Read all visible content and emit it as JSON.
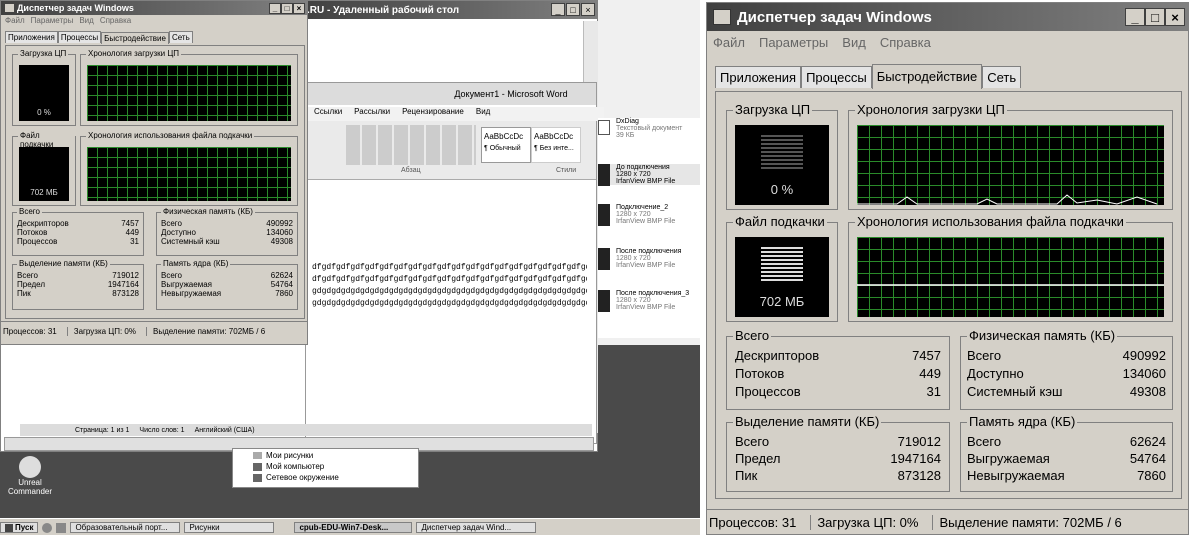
{
  "tm": {
    "title": "Диспетчер задач Windows",
    "menu": [
      "Файл",
      "Параметры",
      "Вид",
      "Справка"
    ],
    "tabs": [
      "Приложения",
      "Процессы",
      "Быстродействие",
      "Сеть"
    ],
    "active_tab": 2,
    "cpu_label": "Загрузка ЦП",
    "cpu_value": "0 %",
    "cpu_history_label": "Хронология загрузки ЦП",
    "pf_label": "Файл подкачки",
    "pf_value": "702 МБ",
    "pf_history_label": "Хронология использования файла подкачки",
    "totals": {
      "label": "Всего",
      "rows": [
        [
          "Дескрипторов",
          "7457"
        ],
        [
          "Потоков",
          "449"
        ],
        [
          "Процессов",
          "31"
        ]
      ]
    },
    "physical": {
      "label": "Физическая память (КБ)",
      "rows": [
        [
          "Всего",
          "490992"
        ],
        [
          "Доступно",
          "134060"
        ],
        [
          "Системный кэш",
          "49308"
        ]
      ]
    },
    "commit": {
      "label": "Выделение памяти (КБ)",
      "rows": [
        [
          "Всего",
          "719012"
        ],
        [
          "Предел",
          "1947164"
        ],
        [
          "Пик",
          "873128"
        ]
      ]
    },
    "kernel": {
      "label": "Память ядра (КБ)",
      "rows": [
        [
          "Всего",
          "62624"
        ],
        [
          "Выгружаемая",
          "54764"
        ],
        [
          "Невыгружаемая",
          "7860"
        ]
      ]
    },
    "status": {
      "processes": "Процессов: 31",
      "cpu": "Загрузка ЦП: 0%",
      "commit": "Выделение памяти: 702МБ / 6"
    }
  },
  "rdp": {
    "title": ".RU - Удаленный рабочий стол"
  },
  "word": {
    "title": "Документ1 - Microsoft Word",
    "ribbon_tabs": [
      "Ссылки",
      "Рассылки",
      "Рецензирование",
      "Вид"
    ],
    "styles": [
      "AaBbCcDc",
      "AaBbCcDc"
    ],
    "style_names": [
      "¶ Обычный",
      "¶ Без инте..."
    ],
    "group_labels": [
      "Абзац",
      "Стили"
    ],
    "text_lines": [
      "dfgdfgdfgdfgdfgdfgdfgdfgdfgdfgdfgdfgdfgdfgdfgdfgdfgdfgdfgdfgdfgdfgdfgdfgdfgd",
      "dfgdfgdfgdfgdfgdfgdfgdfgdfgdfgdfgdfgdfgdfgdfgdfgdfgdfgdfgdfgdfgdfgdfgdfgdfgdfgdfj",
      "gdgdgdgdgdgdgdgdgdgdgdgdgdgdgdgdgdgdgdgdgdgdgdgdgdgdgdgdgdgdgdgdgdgdgdgdg",
      "gdgdgdgdgdgdgdgdgdgdgdgdgdgdgdgdgdgdgdgdgdgdgdgdgdgdgdgdgdgdgdgdgdgdgdgdgc"
    ],
    "statusbar": [
      "Страница: 1 из 1",
      "Число слов: 1",
      "Английский (США)"
    ]
  },
  "files": [
    {
      "name": "DxDiag",
      "l1": "Текстовый документ",
      "l2": "39 КБ"
    },
    {
      "name": "До подключения",
      "l1": "1280 x 720",
      "l2": "IrfanView BMP File"
    },
    {
      "name": "Подключение_2",
      "l1": "1280 x 720",
      "l2": "IrfanView BMP File"
    },
    {
      "name": "После подключения",
      "l1": "1280 x 720",
      "l2": "IrfanView BMP File"
    },
    {
      "name": "После подключения_3",
      "l1": "1280 x 720",
      "l2": "IrfanView BMP File"
    }
  ],
  "explorer_items": [
    "Мои рисунки",
    "Мой компьютер",
    "Сетевое окружение"
  ],
  "desktop_icon": {
    "label1": "Unreal",
    "label2": "Commander"
  },
  "taskbar": {
    "start": "Пуск",
    "items": [
      "Образовательный порт...",
      "Рисунки",
      "cpub-EDU-Win7-Desk...",
      "Диспетчер задач Wind..."
    ]
  }
}
